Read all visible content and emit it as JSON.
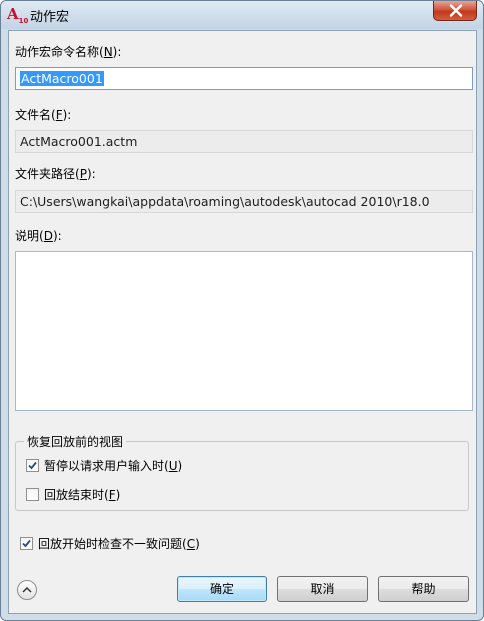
{
  "window": {
    "title": "动作宏",
    "icon": "autocad-icon",
    "icon_text": "A",
    "icon_sub": "10"
  },
  "fields": {
    "command_name_label": "动作宏命令名称(N):",
    "command_name_label_pre": "动作宏命令名称(",
    "command_name_label_key": "N",
    "command_name_label_post": "):",
    "command_name_value": "ActMacro001",
    "file_name_label_pre": "文件名(",
    "file_name_label_key": "F",
    "file_name_label_post": "):",
    "file_name_value": "ActMacro001.actm",
    "folder_path_label_pre": "文件夹路径(",
    "folder_path_label_key": "P",
    "folder_path_label_post": "):",
    "folder_path_value": "C:\\Users\\wangkai\\appdata\\roaming\\autodesk\\autocad 2010\\r18.0",
    "description_label_pre": "说明(",
    "description_label_key": "D",
    "description_label_post": "):",
    "description_value": ""
  },
  "restore_group": {
    "title": "恢复回放前的视图",
    "pause_label_pre": "暂停以请求用户输入时(",
    "pause_label_key": "U",
    "pause_label_post": ")",
    "pause_checked": true,
    "end_label_pre": "回放结束时(",
    "end_label_key": "F",
    "end_label_post": ")",
    "end_checked": false
  },
  "check_inconsistency": {
    "label_pre": "回放开始时检查不一致问题(",
    "label_key": "C",
    "label_post": ")",
    "checked": true
  },
  "buttons": {
    "ok": "确定",
    "cancel": "取消",
    "help": "帮助"
  },
  "colors": {
    "selection": "#3399ff",
    "close_button": "#c0391d",
    "default_button_border": "#3c7fb1"
  }
}
